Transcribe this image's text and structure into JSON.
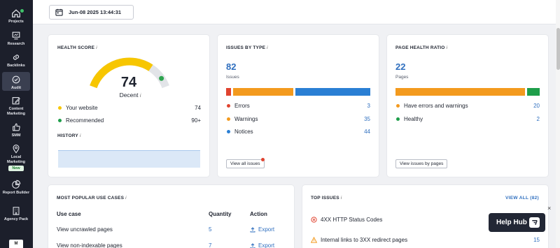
{
  "sidebar": {
    "items": [
      {
        "label": "Projects",
        "icon": "home-icon"
      },
      {
        "label": "Research",
        "icon": "research-icon"
      },
      {
        "label": "Backlinks",
        "icon": "link-icon"
      },
      {
        "label": "Audit",
        "icon": "audit-check-icon"
      },
      {
        "label": "Content Marketing",
        "icon": "edit-icon"
      },
      {
        "label": "SMM",
        "icon": "thumbs-up-icon"
      },
      {
        "label": "Local Marketing",
        "icon": "location-pin-icon"
      },
      {
        "label": "Report Builder",
        "icon": "pie-chart-icon"
      },
      {
        "label": "Agency Pack",
        "icon": "building-icon"
      }
    ],
    "new_badge": "New",
    "bottom_label": "M"
  },
  "topbar": {
    "date": "Jun-08 2025 13:44:31"
  },
  "health_score": {
    "title": "HEALTH SCORE",
    "info": "i",
    "score": "74",
    "rating": "Decent",
    "rating_info": "i",
    "your_website_label": "Your website",
    "your_website_value": "74",
    "recommended_label": "Recommended",
    "recommended_value": "90+",
    "history_title": "HISTORY",
    "history_info": "i",
    "gauge_fraction": 0.74,
    "gauge_color": "#f7c600",
    "gauge_track": "#e2e4e8",
    "gauge_marker": "#2ea44f"
  },
  "issues_by_type": {
    "title": "ISSUES BY TYPE",
    "info": "i",
    "total": "82",
    "total_label": "Issues",
    "bar": [
      {
        "name": "Errors",
        "value": 3,
        "color": "#e0432f"
      },
      {
        "name": "Warnings",
        "value": 35,
        "color": "#f39a1e"
      },
      {
        "name": "Notices",
        "value": 44,
        "color": "#2a7fd4"
      }
    ],
    "rows": [
      {
        "label": "Errors",
        "value": "3",
        "color": "#e0432f"
      },
      {
        "label": "Warnings",
        "value": "35",
        "color": "#f39a1e"
      },
      {
        "label": "Notices",
        "value": "44",
        "color": "#2a7fd4"
      }
    ],
    "button": "View all issues"
  },
  "page_health": {
    "title": "PAGE HEALTH RATIO",
    "info": "i",
    "total": "22",
    "total_label": "Pages",
    "bar": [
      {
        "name": "Have errors and warnings",
        "value": 20,
        "color": "#f39a1e"
      },
      {
        "name": "Healthy",
        "value": 2,
        "color": "#1e9e4a"
      }
    ],
    "rows": [
      {
        "label": "Have errors and warnings",
        "value": "20",
        "color": "#f39a1e"
      },
      {
        "label": "Healthy",
        "value": "2",
        "color": "#1e9e4a"
      }
    ],
    "button": "View issues by pages"
  },
  "use_cases": {
    "title": "MOST POPULAR USE CASES",
    "info": "i",
    "headers": [
      "Use case",
      "Quantity",
      "Action"
    ],
    "rows": [
      {
        "use_case": "View uncrawled pages",
        "quantity": "5",
        "action": "Export"
      },
      {
        "use_case": "View non-indexable pages",
        "quantity": "7",
        "action": "Export"
      }
    ]
  },
  "top_issues": {
    "title": "TOP ISSUES",
    "info": "i",
    "view_all": "VIEW ALL (82)",
    "rows": [
      {
        "label": "4XX HTTP Status Codes",
        "value": "",
        "severity_color": "#e0432f"
      },
      {
        "label": "Internal links to 3XX redirect pages",
        "value": "15",
        "severity_color": "#f39a1e"
      }
    ]
  },
  "help_hub": {
    "label": "Help Hub",
    "close": "×"
  }
}
